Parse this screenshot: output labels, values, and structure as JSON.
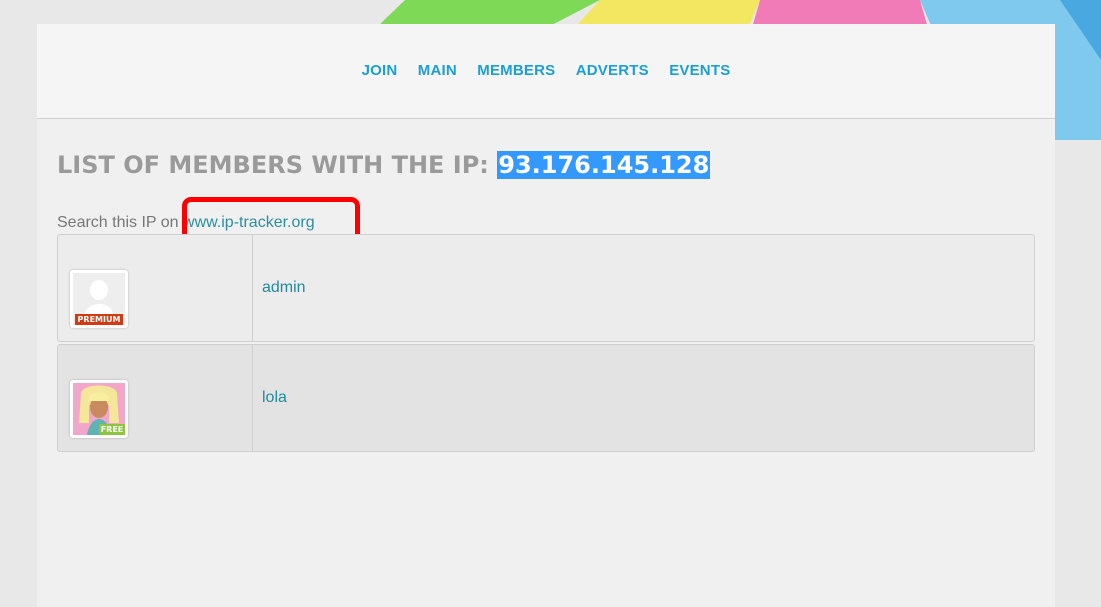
{
  "nav": {
    "items": [
      {
        "label": "JOIN"
      },
      {
        "label": "MAIN"
      },
      {
        "label": "MEMBERS"
      },
      {
        "label": "ADVERTS"
      },
      {
        "label": "EVENTS"
      }
    ]
  },
  "title": {
    "prefix": "LIST OF MEMBERS WITH THE IP:",
    "ip": "93.176.145.128"
  },
  "search": {
    "prefix": "Search this IP on",
    "link_text": "www.ip-tracker.org"
  },
  "members": [
    {
      "name": "admin",
      "badge": "PREMIUM",
      "avatar_icon": "default-user-silhouette-icon"
    },
    {
      "name": "lola",
      "badge": "FREE",
      "avatar_icon": "user-photo"
    }
  ],
  "colors": {
    "nav_link": "#1a9fd6",
    "title": "#9a9a9a",
    "ip_highlight": "#3399ff",
    "link": "#1f8aa0",
    "highlight_box": "#ff0000",
    "premium_badge": "#d23b12",
    "free_badge": "#8cc63f"
  }
}
